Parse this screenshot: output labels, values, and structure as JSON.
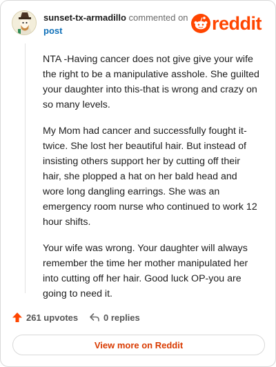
{
  "comment": {
    "author": "sunset-tx-armadillo",
    "action_text": "commented on",
    "post_link": "post",
    "avatar_icon": "snoo-avatar-icon",
    "paragraphs": [
      "NTA -Having cancer does not give give your wife the right to be a manipulative asshole. She guilted your daughter into this-that is wrong and crazy on so many levels.",
      "My Mom had cancer and successfully fought it-twice. She lost her beautiful hair. But instead of insisting others support her by cutting off their hair, she plopped a hat on her bald head and wore long dangling earrings. She was an emergency room nurse who continued to work 12 hour shifts.",
      "Your wife was wrong. Your daughter will always remember the time her mother manipulated her into cutting off her hair. Good luck OP-you are going to need it."
    ]
  },
  "brand": {
    "logo_text": "reddit",
    "logo_icon": "reddit-snoo-icon",
    "accent_color": "#ff4500",
    "link_color": "#0d6fb8",
    "button_text_color": "#d93a00"
  },
  "actions": {
    "upvotes": "261 upvotes",
    "upvote_icon": "upvote-arrow-icon",
    "replies": "0 replies",
    "reply_icon": "reply-arrow-icon"
  },
  "footer": {
    "view_more": "View more on Reddit"
  }
}
